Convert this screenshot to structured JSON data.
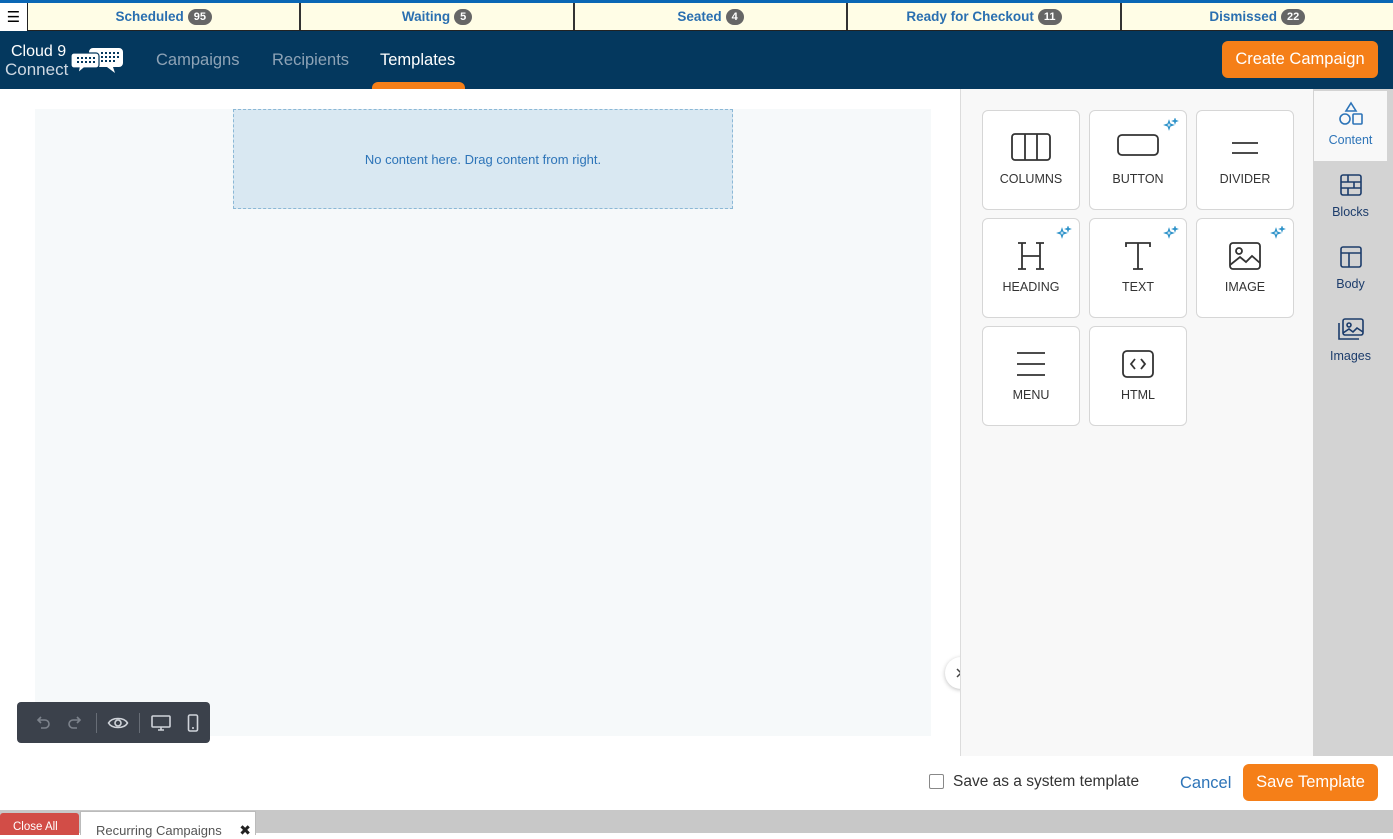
{
  "status_bar": {
    "menu_icon": "hamburger-icon",
    "tabs": [
      {
        "label": "Scheduled",
        "count": "95"
      },
      {
        "label": "Waiting",
        "count": "5"
      },
      {
        "label": "Seated",
        "count": "4"
      },
      {
        "label": "Ready for Checkout",
        "count": "11"
      },
      {
        "label": "Dismissed",
        "count": "22"
      }
    ]
  },
  "brand": {
    "line1": "Cloud 9",
    "line2": "Connect"
  },
  "nav": {
    "items": [
      {
        "label": "Campaigns"
      },
      {
        "label": "Recipients"
      },
      {
        "label": "Templates"
      }
    ],
    "active_index": 2,
    "create_button": "Create Campaign"
  },
  "editor": {
    "empty_message": "No content here. Drag content from right.",
    "toolbar": [
      "undo-icon",
      "redo-icon",
      "preview-eye-icon",
      "desktop-icon",
      "mobile-icon"
    ],
    "content_tools": [
      {
        "label": "COLUMNS",
        "icon": "columns-icon",
        "ai": false
      },
      {
        "label": "BUTTON",
        "icon": "button-icon",
        "ai": true
      },
      {
        "label": "DIVIDER",
        "icon": "divider-icon",
        "ai": false
      },
      {
        "label": "HEADING",
        "icon": "heading-icon",
        "ai": true
      },
      {
        "label": "TEXT",
        "icon": "text-icon",
        "ai": true
      },
      {
        "label": "IMAGE",
        "icon": "image-icon",
        "ai": true
      },
      {
        "label": "MENU",
        "icon": "menu-icon",
        "ai": false
      },
      {
        "label": "HTML",
        "icon": "html-icon",
        "ai": false
      }
    ],
    "side_tabs": [
      {
        "label": "Content",
        "icon": "shapes-icon"
      },
      {
        "label": "Blocks",
        "icon": "blocks-icon"
      },
      {
        "label": "Body",
        "icon": "layout-icon"
      },
      {
        "label": "Images",
        "icon": "images-icon"
      }
    ],
    "active_side_tab": 0
  },
  "footer": {
    "system_template_label": "Save as a system template",
    "system_template_checked": false,
    "cancel_label": "Cancel",
    "save_label": "Save Template"
  },
  "window_tabs": {
    "close_all": "Close All",
    "tabs": [
      {
        "label": "Recurring Campaigns"
      }
    ]
  },
  "colors": {
    "accent": "#f57f18",
    "navbar": "#04385e",
    "link": "#2d74b8",
    "status_bar_bg": "#fffde6"
  }
}
